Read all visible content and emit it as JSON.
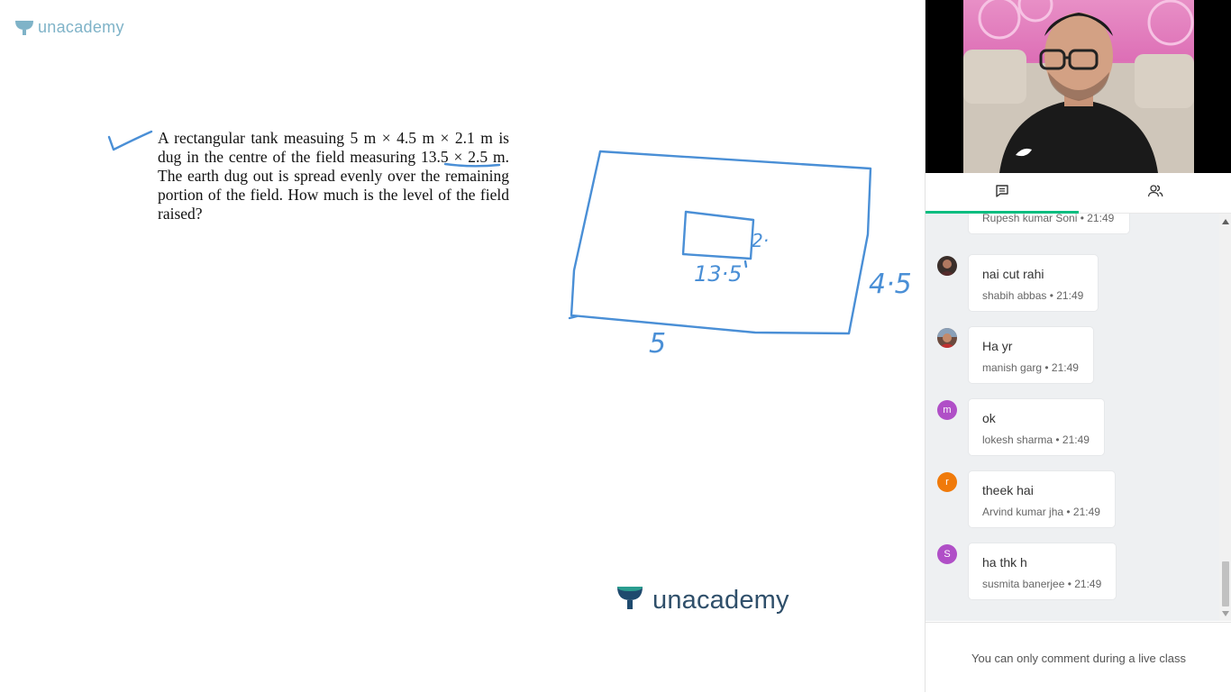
{
  "brand": {
    "name": "unacademy"
  },
  "question": {
    "text": "A rectangular tank measuing 5 m × 4.5 m × 2.1 m is dug in the centre of the field measuring 13.5 × 2.5 m. The earth dug out is spread evenly over the remaining portion of the field. How much is the level of the field raised?"
  },
  "annotations": {
    "inner_width": "13·5",
    "inner_height": "2·",
    "outer_height": "4·5",
    "outer_width": "5"
  },
  "tabs": [
    {
      "icon": "chat-icon",
      "active": true
    },
    {
      "icon": "people-icon",
      "active": false
    }
  ],
  "chat": {
    "messages": [
      {
        "text": "",
        "author": "Rupesh kumar Soni",
        "time": "21:49",
        "meta": "Rupesh kumar Soni • 21:49",
        "avatar": ""
      },
      {
        "text": "nai cut rahi",
        "author": "shabih abbas",
        "time": "21:49",
        "meta": "shabih abbas • 21:49",
        "avatar": ""
      },
      {
        "text": "Ha yr",
        "author": "manish garg",
        "time": "21:49",
        "meta": "manish garg • 21:49",
        "avatar": ""
      },
      {
        "text": "ok",
        "author": "lokesh sharma",
        "time": "21:49",
        "meta": "lokesh sharma • 21:49",
        "avatar": "m"
      },
      {
        "text": "theek hai",
        "author": "Arvind kumar jha",
        "time": "21:49",
        "meta": "Arvind kumar jha • 21:49",
        "avatar": "r"
      },
      {
        "text": "ha thk h",
        "author": "susmita banerjee",
        "time": "21:49",
        "meta": "susmita banerjee • 21:49",
        "avatar": "S"
      }
    ]
  },
  "footer": {
    "notice": "You can only comment during a live class"
  },
  "colors": {
    "accent": "#08bd80",
    "ink": "#4a8fd6",
    "avatar_purple": "#b04fc7",
    "avatar_orange": "#f07a0a"
  }
}
